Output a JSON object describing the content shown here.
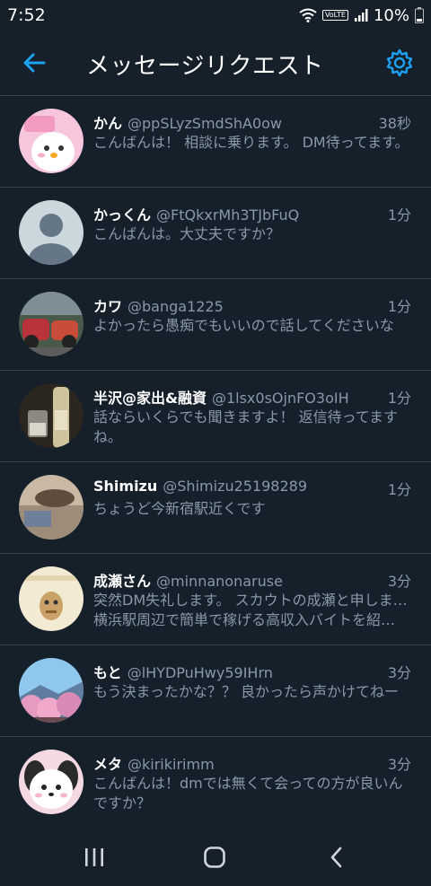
{
  "status_bar": {
    "time": "7:52",
    "volte": "VoLTE",
    "battery": "10%"
  },
  "header": {
    "title": "メッセージリクエスト",
    "icons": {
      "back": "back-arrow-icon",
      "settings": "gear-icon"
    }
  },
  "requests": [
    {
      "name": "かん",
      "handle": "@ppSLyzSmdShA0ow",
      "time": "38秒",
      "preview": "こんばんは！ 相談に乗ります。 DM待ってます。"
    },
    {
      "name": "かっくん",
      "handle": "@FtQkxrMh3TJbFuQ",
      "time": "1分",
      "preview": "こんばんは。大丈夫ですか？"
    },
    {
      "name": "カワ",
      "handle": "@banga1225",
      "time": "1分",
      "preview": "よかったら愚痴でもいいので話してくださいな"
    },
    {
      "name": "半沢@家出&融資",
      "handle": "@1lsx0sOjnFO3oIH",
      "time": "1分",
      "preview": "話ならいくらでも聞きますよ！ 返信待ってますね。"
    },
    {
      "name": "Shimizu",
      "handle": "@Shimizu25198289",
      "time": "1分",
      "preview": "ちょうど今新宿駅近くです"
    },
    {
      "name": "成瀬さん",
      "handle": "@minnanonaruse",
      "time": "3分",
      "preview": "突然DM失礼します。 スカウトの成瀬と申します🙇",
      "preview2": "横浜駅周辺で簡単で稼げる高収入バイトを紹介し…"
    },
    {
      "name": "もと",
      "handle": "@lHYDPuHwy59IHrn",
      "time": "3分",
      "preview": "もう決まったかな？？ 良かったら声かけてねー"
    },
    {
      "name": "メタ",
      "handle": "@kirikirimm",
      "time": "3分",
      "preview": "こんばんは！dmでは無くて会っての方が良いんですか？"
    }
  ],
  "colors": {
    "background": "#15202b",
    "accent": "#1da1f2",
    "secondary_text": "#8899a6",
    "divider": "#38444d"
  },
  "nav_bar": {
    "icons": [
      "recent-apps-icon",
      "home-icon",
      "back-icon"
    ]
  }
}
